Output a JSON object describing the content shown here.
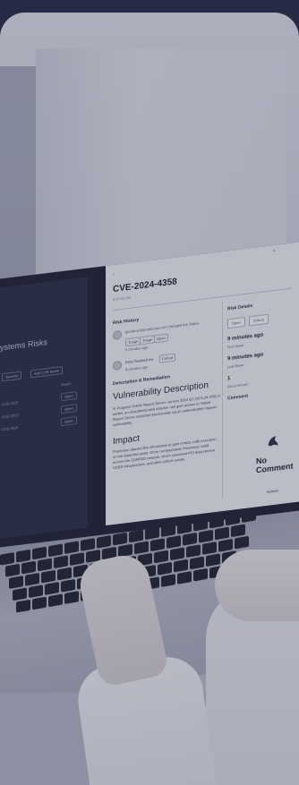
{
  "left_app": {
    "nav_title": "ystems  Risks",
    "filter_button_1": "Severity",
    "filter_button_2": "Add CVE Name",
    "status_header": "Status",
    "rows": [
      {
        "name": "CVE-2022",
        "status": "Open"
      },
      {
        "name": "CVE-2023",
        "status": "Open"
      },
      {
        "name": "CVE-2024",
        "status": "Open"
      }
    ]
  },
  "panel": {
    "title": "CVE-2024-4358",
    "timestamp": "9:00:00 AM",
    "risk_history_label": "Risk History",
    "history_entry_text": "ginalleon@praetorian.com changed the Status",
    "history_chips": [
      "Triage",
      "Triage",
      "Open"
    ],
    "history_time": "9 minutes ago",
    "first_tracked_label": "First Tracked on",
    "first_tracked_chip": "Critical",
    "first_tracked_time": "9 minutes ago",
    "desc_section_label": "Description & Remediation",
    "vuln_heading": "Vulnerability Description",
    "vuln_text": "In Progress Telerik Report Server, version 2024 Q1 (10.0.24.305) or earlier, an unauthenticated attacker can gain access to Telerik Report Server restricted functionality via an authentication bypass vulnerability.",
    "impact_heading": "Impact",
    "impact_text": "Praetorian abused this information to gain remote code execution on the impacted asset. Once compromised, Praetorian could access the CDRPED network, which contained PCI data servers, CDED infrastructure, and other critical assets.",
    "risk_details_label": "Risk Details",
    "status_select": "Open",
    "severity_select": "Critical",
    "first_seen_value": "9 minutes ago",
    "first_seen_label": "First Seen",
    "last_seen_value": "9 minutes ago",
    "last_seen_label": "Last Seen",
    "occurrences_value": "1",
    "occurrences_label": "Occurrences",
    "comment_label": "Comment",
    "no_comment": "No Comment",
    "footer_button": "Actions"
  }
}
